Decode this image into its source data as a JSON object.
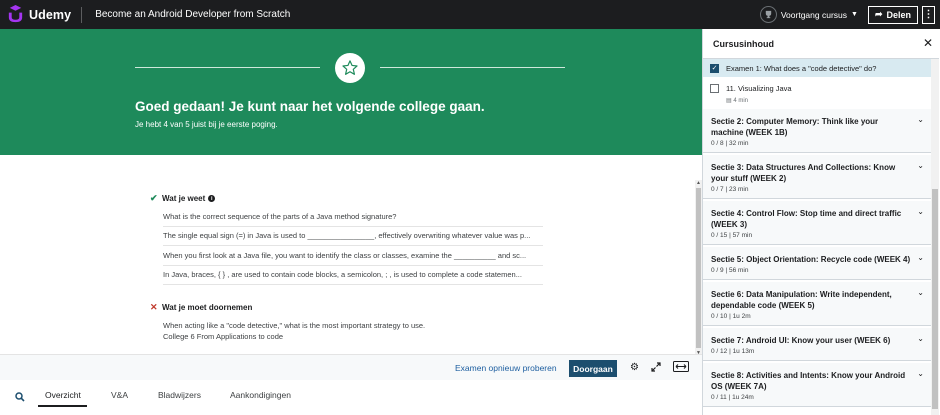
{
  "topbar": {
    "brand": "Udemy",
    "course_title": "Become an Android Developer from Scratch",
    "progress_label": "Voortgang cursus",
    "share_label": "Delen"
  },
  "banner": {
    "title": "Goed gedaan! Je kunt naar het volgende college gaan.",
    "subtitle": "Je hebt 4 van 5 juist bij je eerste poging."
  },
  "know": {
    "heading": "Wat je weet",
    "items": [
      "What is the correct sequence of the parts of a Java method signature?",
      "The single equal sign (=) in Java is used to ________________, effectively overwriting whatever value was p...",
      "When you first look at a Java file, you want to identify the class or classes, examine the __________ and sc...",
      "In Java, braces, { } , are used to contain code blocks, a semicolon, ; , is used to complete a code statemen..."
    ]
  },
  "review": {
    "heading": "Wat je moet doornemen",
    "question": "When acting like a \"code detective,\" what is the most important strategy to use.",
    "reference": "College 6 From Applications to code"
  },
  "actions": {
    "retry_label": "Examen opnieuw proberen",
    "continue_label": "Doorgaan"
  },
  "tabs": [
    "Overzicht",
    "V&A",
    "Bladwijzers",
    "Aankondigingen"
  ],
  "sidebar": {
    "title": "Cursusinhoud",
    "lectures": [
      {
        "label": "Examen 1: What does a \"code detective\" do?",
        "checked": true,
        "duration": ""
      },
      {
        "label": "11. Visualizing Java",
        "checked": false,
        "duration": "4 min"
      }
    ],
    "sections": [
      {
        "title": "Sectie 2: Computer Memory: Think like your machine (WEEK 1B)",
        "meta": "0 / 8 | 32 min"
      },
      {
        "title": "Sectie 3: Data Structures And Collections: Know your stuff (WEEK 2)",
        "meta": "0 / 7 | 23 min"
      },
      {
        "title": "Sectie 4: Control Flow: Stop time and direct traffic (WEEK 3)",
        "meta": "0 / 15 | 57 min"
      },
      {
        "title": "Sectie 5: Object Orientation: Recycle code (WEEK 4)",
        "meta": "0 / 9 | 56 min"
      },
      {
        "title": "Sectie 6: Data Manipulation: Write independent, dependable code (WEEK 5)",
        "meta": "0 / 10 | 1u 2m"
      },
      {
        "title": "Sectie 7: Android UI: Know your user (WEEK 6)",
        "meta": "0 / 12 | 1u 13m"
      },
      {
        "title": "Sectie 8: Activities and Intents: Know your Android OS (WEEK 7A)",
        "meta": "0 / 11 | 1u 24m"
      }
    ]
  },
  "colors": {
    "banner": "#1e8a5b",
    "topbar": "#1c1d1f",
    "primary_button": "#1c4e6e",
    "link": "#1e5fa0"
  }
}
